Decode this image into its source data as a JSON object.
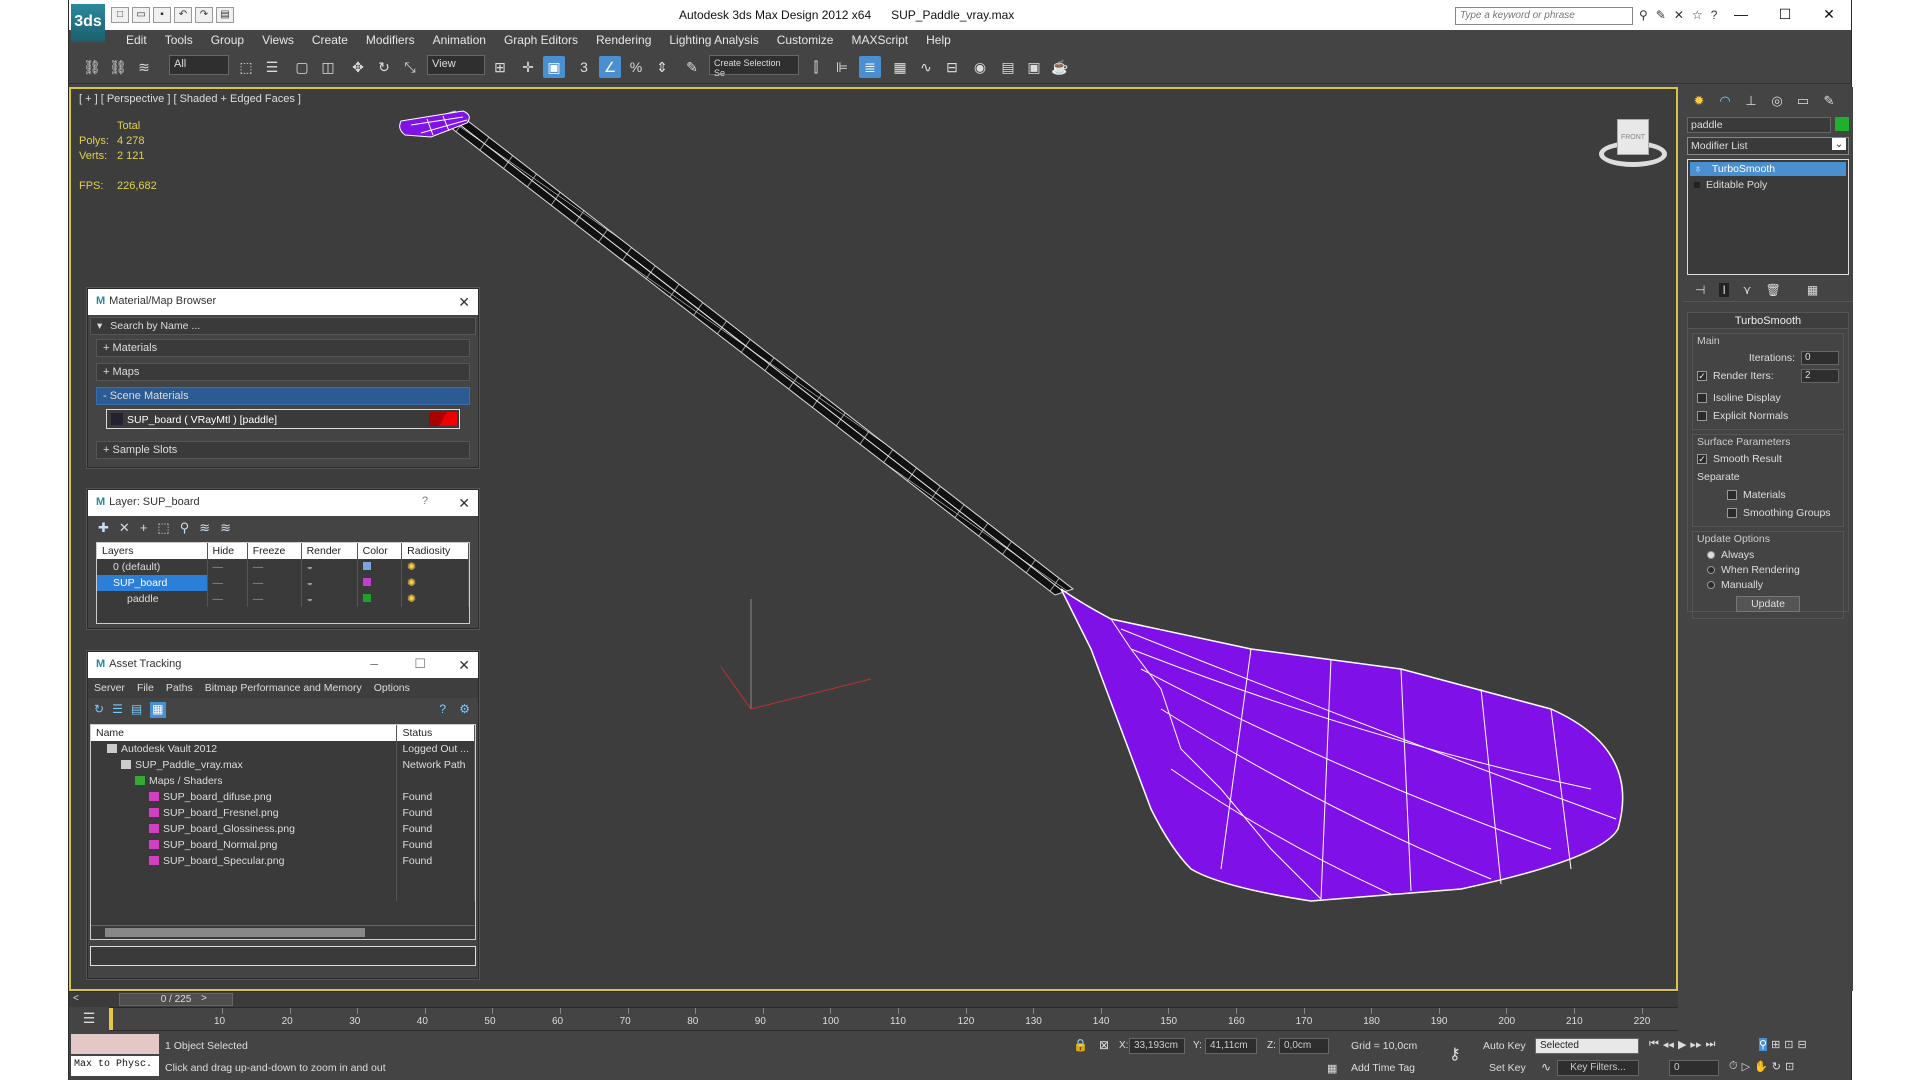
{
  "window": {
    "app_title": "Autodesk 3ds Max Design 2012 x64",
    "file": "SUP_Paddle_vray.max",
    "search_placeholder": "Type a keyword or phrase",
    "logo_text": "3ds"
  },
  "menu": [
    "Edit",
    "Tools",
    "Group",
    "Views",
    "Create",
    "Modifiers",
    "Animation",
    "Graph Editors",
    "Rendering",
    "Lighting Analysis",
    "Customize",
    "MAXScript",
    "Help"
  ],
  "toolbar": {
    "selection_filter": "All",
    "ref_coord": "View",
    "named_selection": "Create Selection Se"
  },
  "viewport": {
    "label": "[ + ] [ Perspective ] [ Shaded + Edged Faces ]",
    "stats": {
      "total_label": "Total",
      "polys_label": "Polys:",
      "polys": "4 278",
      "verts_label": "Verts:",
      "verts": "2 121",
      "fps_label": "FPS:",
      "fps": "226,682"
    },
    "viewcube_label": "FRONT"
  },
  "material_browser": {
    "title": "Material/Map Browser",
    "search_placeholder": "Search by Name ...",
    "sections": [
      "+ Materials",
      "+ Maps",
      "- Scene Materials",
      "+ Sample Slots"
    ],
    "scene_material": "SUP_board  ( VRayMtl ) [paddle]"
  },
  "layer_dialog": {
    "title": "Layer: SUP_board",
    "help": "?",
    "columns": [
      "Layers",
      "Hide",
      "Freeze",
      "Render",
      "Color",
      "Radiosity"
    ],
    "rows": [
      {
        "name": "0 (default)",
        "color": "#7aa6d9"
      },
      {
        "name": "SUP_board",
        "color": "#c040c8"
      },
      {
        "name": "paddle",
        "color": "#20a030"
      }
    ]
  },
  "asset_tracking": {
    "title": "Asset Tracking",
    "menu": [
      "Server",
      "File",
      "Paths",
      "Bitmap Performance and Memory",
      "Options"
    ],
    "columns": [
      "Name",
      "Status"
    ],
    "rows": [
      {
        "name": "Autodesk Vault 2012",
        "status": "Logged Out ..."
      },
      {
        "name": "SUP_Paddle_vray.max",
        "status": "Network Path"
      },
      {
        "name": "Maps / Shaders",
        "status": ""
      },
      {
        "name": "SUP_board_difuse.png",
        "status": "Found"
      },
      {
        "name": "SUP_board_Fresnel.png",
        "status": "Found"
      },
      {
        "name": "SUP_board_Glossiness.png",
        "status": "Found"
      },
      {
        "name": "SUP_board_Normal.png",
        "status": "Found"
      },
      {
        "name": "SUP_board_Specular.png",
        "status": "Found"
      }
    ]
  },
  "command_panel": {
    "object_name": "paddle",
    "object_color": "#20b030",
    "modifier_list": "Modifier List",
    "stack": [
      "TurboSmooth",
      "Editable Poly"
    ],
    "rollout": "TurboSmooth",
    "main": "Main",
    "iterations_label": "Iterations:",
    "iterations": "0",
    "render_iters_label": "Render Iters:",
    "render_iters": "2",
    "isoline": "Isoline Display",
    "explicit_normals": "Explicit Normals",
    "surface_params": "Surface Parameters",
    "smooth_result": "Smooth Result",
    "separate": "Separate",
    "materials": "Materials",
    "smoothing_groups": "Smoothing Groups",
    "update_options": "Update Options",
    "always": "Always",
    "when_rendering": "When Rendering",
    "manually": "Manually",
    "update_button": "Update"
  },
  "timeline": {
    "slider": "0 / 225",
    "ticks": [
      "10",
      "20",
      "30",
      "40",
      "50",
      "60",
      "70",
      "80",
      "90",
      "100",
      "110",
      "120",
      "130",
      "140",
      "150",
      "160",
      "170",
      "180",
      "190",
      "200",
      "210",
      "220"
    ]
  },
  "status": {
    "max_to_physc": "Max to Physc.",
    "selected": "1 Object Selected",
    "prompt": "Click and drag up-and-down to zoom in and out",
    "x_label": "X:",
    "x": "33,193cm",
    "y_label": "Y:",
    "y": "41,11cm",
    "z_label": "Z:",
    "z": "0,0cm",
    "grid": "Grid = 10,0cm",
    "add_time_tag": "Add Time Tag",
    "auto_key": "Auto Key",
    "set_key": "Set Key",
    "key_mode": "Selected",
    "key_filters": "Key Filters...",
    "frame": "0"
  }
}
